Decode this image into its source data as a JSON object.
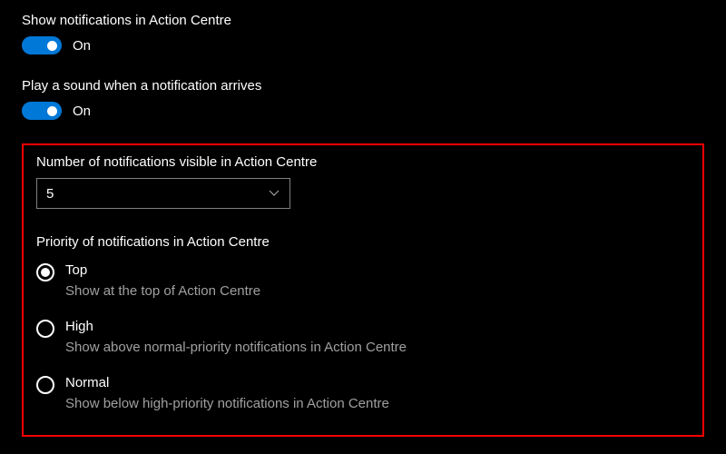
{
  "notifications_toggle": {
    "label": "Show notifications in Action Centre",
    "state": "On"
  },
  "sound_toggle": {
    "label": "Play a sound when a notification arrives",
    "state": "On"
  },
  "notification_count": {
    "label": "Number of notifications visible in Action Centre",
    "value": "5"
  },
  "priority": {
    "label": "Priority of notifications in Action Centre",
    "options": [
      {
        "title": "Top",
        "desc": "Show at the top of Action Centre",
        "selected": true
      },
      {
        "title": "High",
        "desc": "Show above normal-priority notifications in Action Centre",
        "selected": false
      },
      {
        "title": "Normal",
        "desc": "Show below high-priority notifications in Action Centre",
        "selected": false
      }
    ]
  }
}
